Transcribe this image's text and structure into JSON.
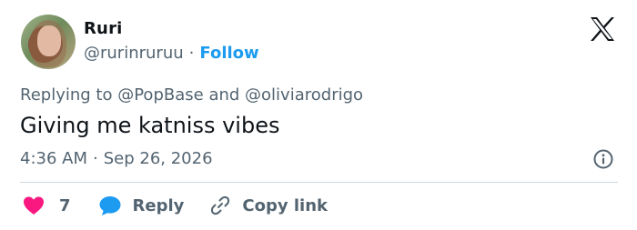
{
  "user": {
    "name": "Ruri",
    "handle": "@rurinruruu",
    "separator": "·",
    "follow_label": "Follow"
  },
  "reply_context": {
    "prefix": "Replying to",
    "mention1": "@PopBase",
    "conjunction": "and",
    "mention2": "@oliviarodrigo"
  },
  "tweet": {
    "text": "Giving me katniss vibes",
    "time": "4:36 AM",
    "separator": "·",
    "date": "Sep 26, 2026"
  },
  "actions": {
    "like_count": "7",
    "reply_label": "Reply",
    "copy_link_label": "Copy link"
  },
  "icons": {
    "logo": "x-logo-icon",
    "info": "info-icon",
    "like": "heart-icon",
    "reply": "speech-bubble-icon",
    "copy": "link-icon"
  },
  "colors": {
    "accent": "#1d9bf0",
    "like": "#f91880",
    "text": "#0f1419",
    "muted": "#536471",
    "divider": "#cfd9de"
  }
}
